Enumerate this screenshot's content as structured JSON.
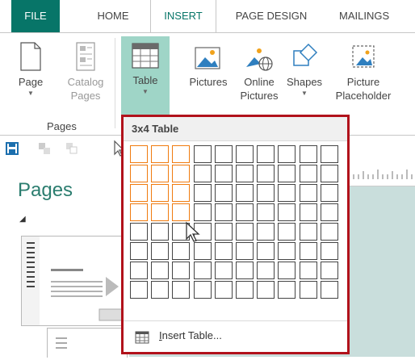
{
  "tabs": [
    {
      "label": "FILE"
    },
    {
      "label": "HOME"
    },
    {
      "label": "INSERT"
    },
    {
      "label": "PAGE DESIGN"
    },
    {
      "label": "MAILINGS"
    }
  ],
  "ribbon": {
    "page_label": "Page",
    "catalog_pages_line1": "Catalog",
    "catalog_pages_line2": "Pages",
    "table_label": "Table",
    "pictures_label": "Pictures",
    "online_pictures_line1": "Online",
    "online_pictures_line2": "Pictures",
    "shapes_label": "Shapes",
    "picture_placeholder_line1": "Picture",
    "picture_placeholder_line2": "Placeholder",
    "group_pages": "Pages"
  },
  "pane": {
    "title": "Pages"
  },
  "table_dropdown": {
    "header": "3x4 Table",
    "grid_columns": 10,
    "grid_rows": 8,
    "selected_columns": 3,
    "selected_rows": 4,
    "insert_table_prefix": "I",
    "insert_table_rest": "nsert Table..."
  },
  "colors": {
    "accent": "#077568",
    "selected_button": "#9fd5c7",
    "highlight_cell": "#f07b0f",
    "callout_border": "#b1121b"
  }
}
